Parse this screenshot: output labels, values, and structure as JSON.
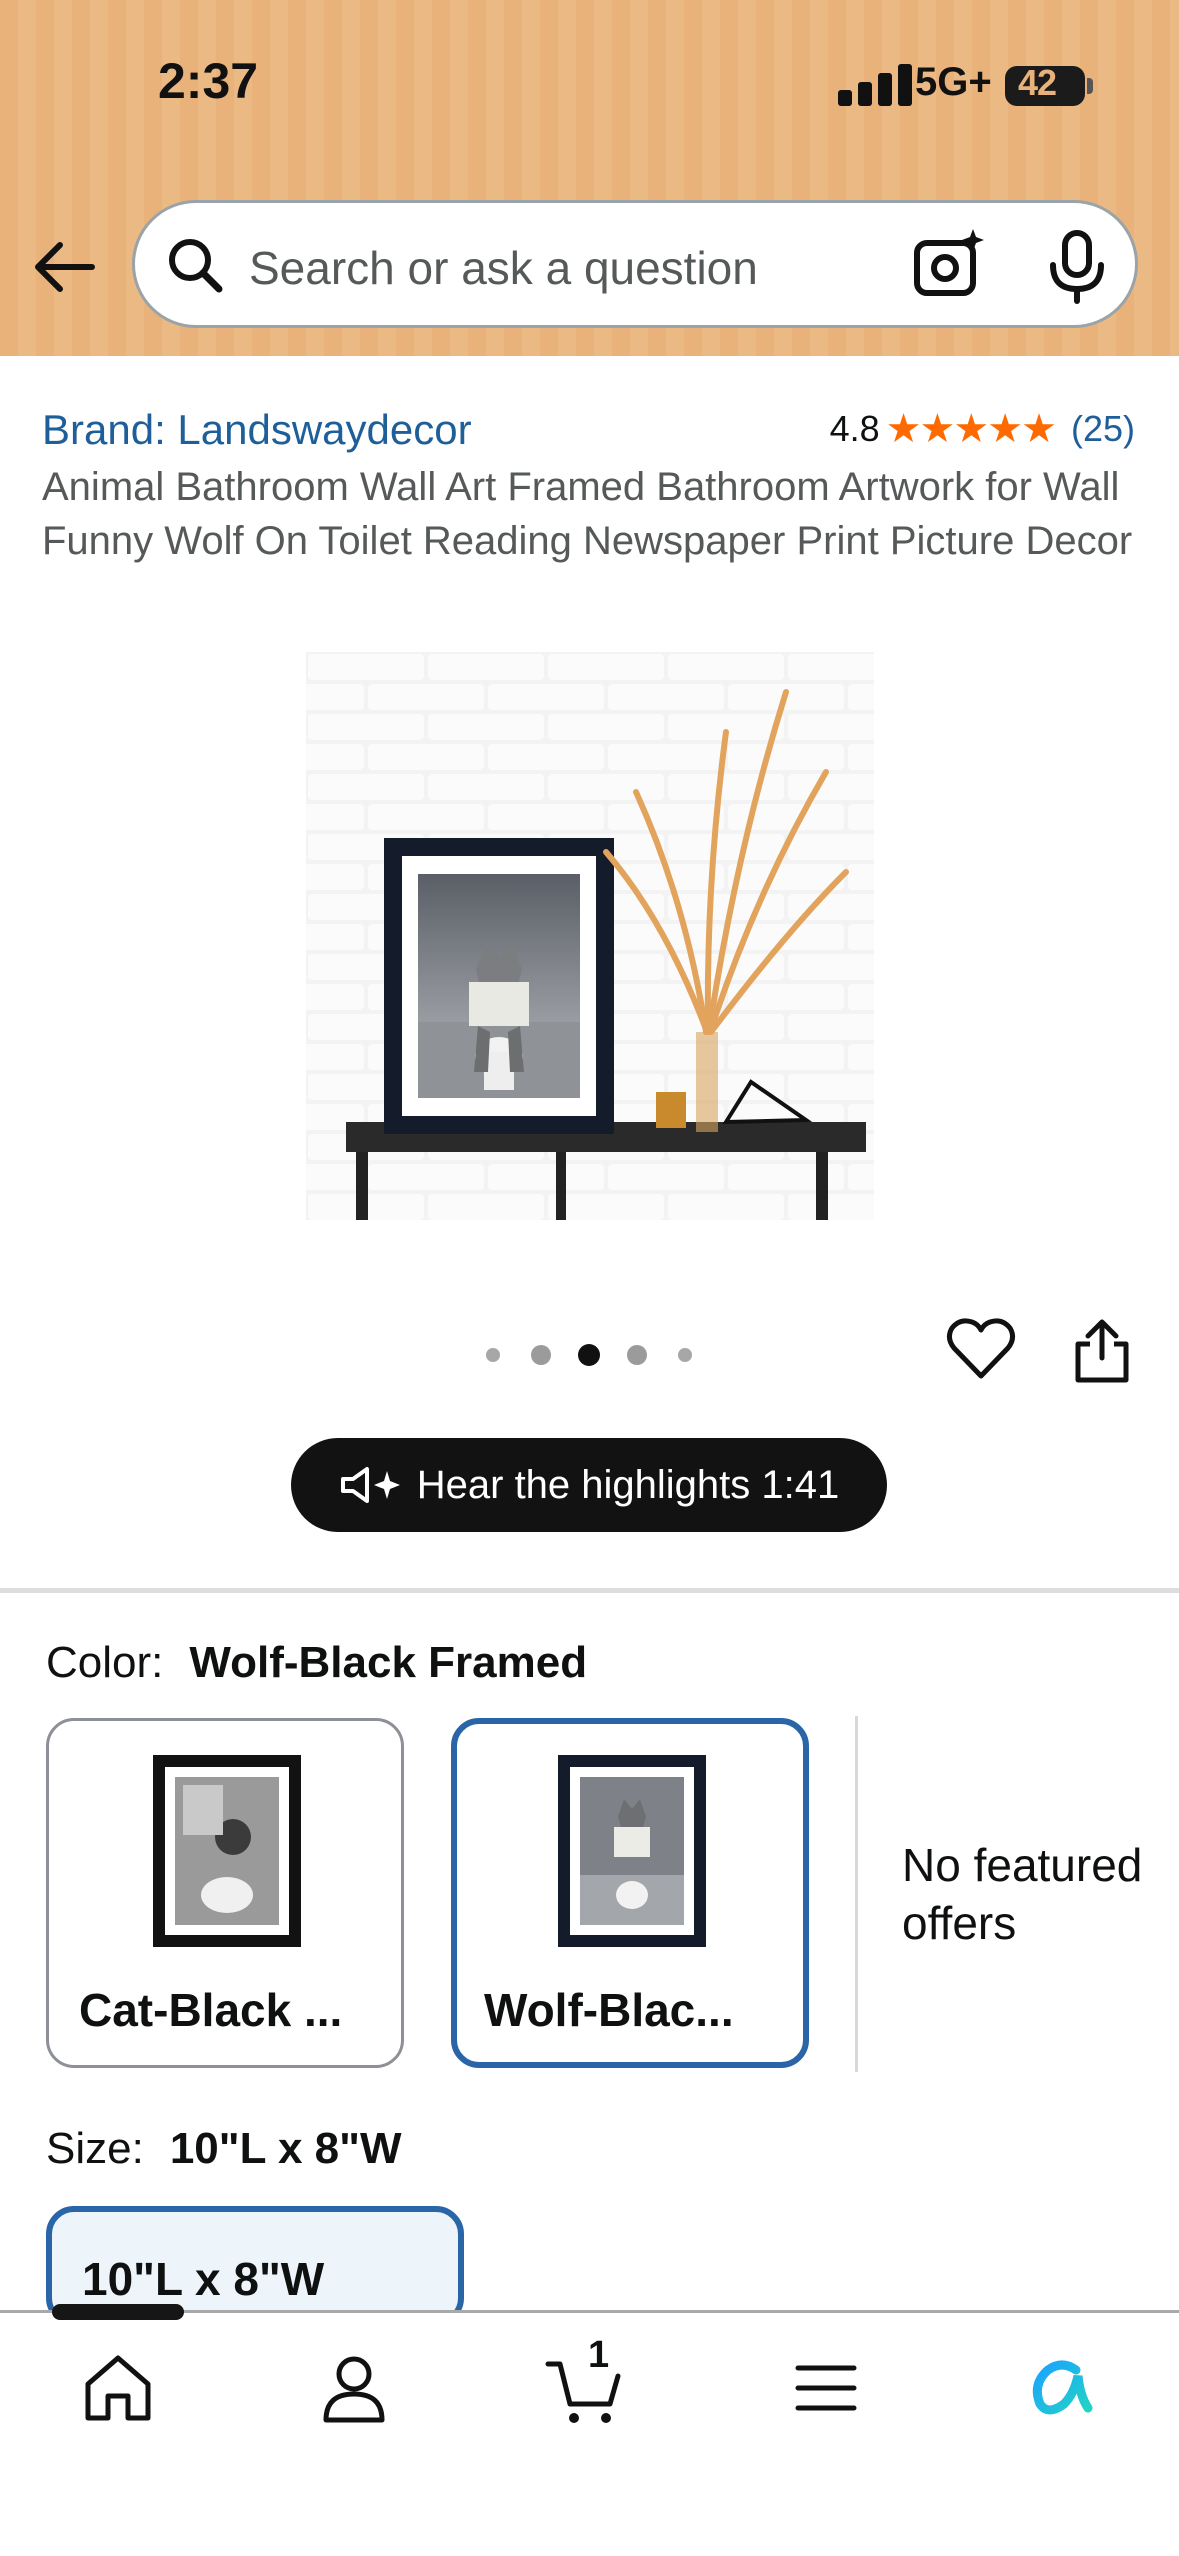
{
  "status_bar": {
    "time": "2:37",
    "network": "5G+",
    "battery": "42"
  },
  "search": {
    "placeholder": "Search or ask a question"
  },
  "product": {
    "brand": "Brand: Landswaydecor",
    "rating": "4.8",
    "stars": "★★★★★",
    "rating_count": "(25)",
    "title": "Animal Bathroom Wall Art Framed Bathroom Artwork for Wall Funny Wolf On Toilet Reading Newspaper Print Picture Decor",
    "image_count": 5,
    "current_image": 3
  },
  "highlights": {
    "label": "Hear the highlights 1:41"
  },
  "color": {
    "label": "Color:",
    "selected": "Wolf-Black Framed",
    "options": [
      {
        "label": "Cat-Black ...",
        "selected": false
      },
      {
        "label": "Wolf-Blac...",
        "selected": true
      }
    ],
    "no_offers": "No featured offers"
  },
  "size": {
    "label": "Size:",
    "selected": "10\"L x 8\"W",
    "options": [
      {
        "label": "10\"L x 8\"W",
        "selected": true
      }
    ]
  },
  "bottom_nav": {
    "cart_count": "1",
    "items": [
      "home-icon",
      "account-icon",
      "cart-icon",
      "menu-icon",
      "rufus-ai-icon"
    ]
  },
  "colors": {
    "header": "#e8b27a",
    "link": "#1f5f99",
    "selected_border": "#2a65a8",
    "star": "#ff6a00"
  }
}
